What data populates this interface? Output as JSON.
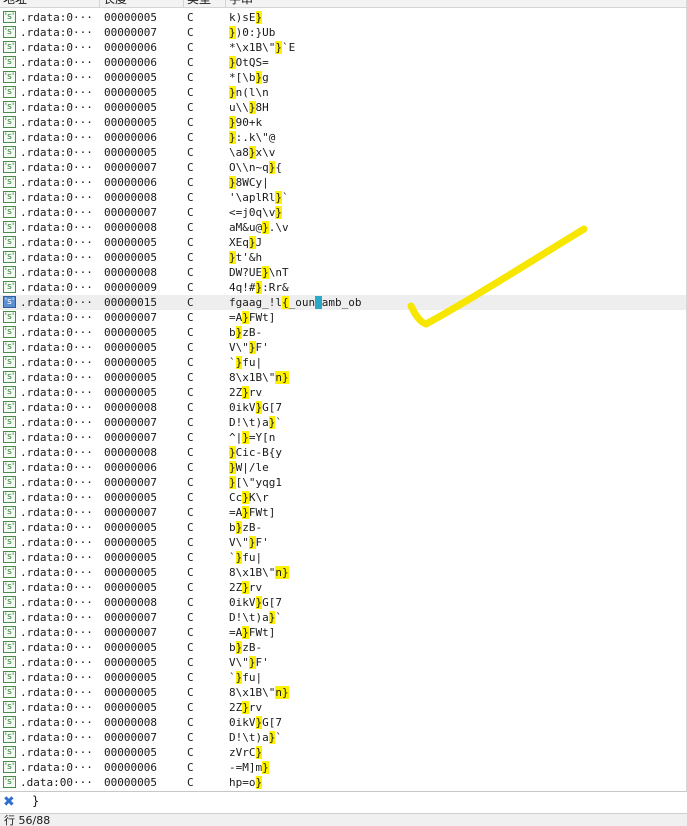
{
  "header": {
    "col_address": "地址",
    "col_length": "长度",
    "col_type": "类型",
    "col_string": "字串"
  },
  "icon": {
    "name": "string-item-icon",
    "glyph": "'s'"
  },
  "rows": [
    {
      "addr": ".rdata:0···",
      "len": "00000005",
      "type": "C",
      "s": [
        [
          "k)sE",
          0
        ],
        [
          "}",
          1
        ]
      ]
    },
    {
      "addr": ".rdata:0···",
      "len": "00000007",
      "type": "C",
      "s": [
        [
          "}",
          1
        ],
        [
          ")0:}Ub",
          0
        ]
      ]
    },
    {
      "addr": ".rdata:0···",
      "len": "00000006",
      "type": "C",
      "s": [
        [
          "*\\x1B\\\"",
          0
        ],
        [
          "}",
          1
        ],
        [
          "`E",
          0
        ]
      ]
    },
    {
      "addr": ".rdata:0···",
      "len": "00000006",
      "type": "C",
      "s": [
        [
          "}",
          1
        ],
        [
          "OtQS=",
          0
        ]
      ]
    },
    {
      "addr": ".rdata:0···",
      "len": "00000005",
      "type": "C",
      "s": [
        [
          "*[\\b",
          0
        ],
        [
          "}",
          1
        ],
        [
          "g",
          0
        ]
      ]
    },
    {
      "addr": ".rdata:0···",
      "len": "00000005",
      "type": "C",
      "s": [
        [
          "}",
          1
        ],
        [
          "n(l\\n",
          0
        ]
      ]
    },
    {
      "addr": ".rdata:0···",
      "len": "00000005",
      "type": "C",
      "s": [
        [
          "u\\\\",
          0
        ],
        [
          "}",
          1
        ],
        [
          "8H",
          0
        ]
      ]
    },
    {
      "addr": ".rdata:0···",
      "len": "00000005",
      "type": "C",
      "s": [
        [
          "}",
          1
        ],
        [
          "90+k",
          0
        ]
      ]
    },
    {
      "addr": ".rdata:0···",
      "len": "00000006",
      "type": "C",
      "s": [
        [
          "}",
          1
        ],
        [
          ":.k\\\"@",
          0
        ]
      ]
    },
    {
      "addr": ".rdata:0···",
      "len": "00000005",
      "type": "C",
      "s": [
        [
          "\\a8",
          0
        ],
        [
          "}",
          1
        ],
        [
          "x\\v",
          0
        ]
      ]
    },
    {
      "addr": ".rdata:0···",
      "len": "00000007",
      "type": "C",
      "s": [
        [
          "O\\\\n~q",
          0
        ],
        [
          "}",
          1
        ],
        [
          "{",
          0
        ]
      ]
    },
    {
      "addr": ".rdata:0···",
      "len": "00000006",
      "type": "C",
      "s": [
        [
          "}",
          1
        ],
        [
          "8WCy|",
          0
        ]
      ]
    },
    {
      "addr": ".rdata:0···",
      "len": "00000008",
      "type": "C",
      "s": [
        [
          "'\\aplRl",
          0
        ],
        [
          "}",
          1
        ],
        [
          "`",
          0
        ]
      ]
    },
    {
      "addr": ".rdata:0···",
      "len": "00000007",
      "type": "C",
      "s": [
        [
          "<=j0q\\v",
          0
        ],
        [
          "}",
          1
        ]
      ]
    },
    {
      "addr": ".rdata:0···",
      "len": "00000008",
      "type": "C",
      "s": [
        [
          "aM&u@",
          0
        ],
        [
          "}",
          1
        ],
        [
          ".\\v",
          0
        ]
      ]
    },
    {
      "addr": ".rdata:0···",
      "len": "00000005",
      "type": "C",
      "s": [
        [
          "XEq",
          0
        ],
        [
          "}",
          1
        ],
        [
          "J",
          0
        ]
      ]
    },
    {
      "addr": ".rdata:0···",
      "len": "00000005",
      "type": "C",
      "s": [
        [
          "}",
          1
        ],
        [
          "t'&h",
          0
        ]
      ]
    },
    {
      "addr": ".rdata:0···",
      "len": "00000008",
      "type": "C",
      "s": [
        [
          "DW?UE",
          0
        ],
        [
          "}",
          1
        ],
        [
          "\\nT",
          0
        ]
      ]
    },
    {
      "addr": ".rdata:0···",
      "len": "00000009",
      "type": "C",
      "s": [
        [
          "4q!#",
          0
        ],
        [
          "}",
          1
        ],
        [
          ":Rr&",
          0
        ]
      ]
    },
    {
      "addr": ".rdata:0···",
      "len": "00000015",
      "type": "C",
      "sel": true,
      "s": [
        [
          "fgaag_!l",
          0
        ],
        [
          "{",
          1
        ],
        [
          "_oun",
          0
        ],
        [
          "}",
          2
        ],
        [
          "amb_ob",
          0
        ]
      ]
    },
    {
      "addr": ".rdata:0···",
      "len": "00000007",
      "type": "C",
      "s": [
        [
          "=A",
          0
        ],
        [
          "}",
          1
        ],
        [
          "FWt]",
          0
        ]
      ]
    },
    {
      "addr": ".rdata:0···",
      "len": "00000005",
      "type": "C",
      "s": [
        [
          "b",
          0
        ],
        [
          "}",
          1
        ],
        [
          "zB-",
          0
        ]
      ]
    },
    {
      "addr": ".rdata:0···",
      "len": "00000005",
      "type": "C",
      "s": [
        [
          "V\\\"",
          0
        ],
        [
          "}",
          1
        ],
        [
          "F'",
          0
        ]
      ]
    },
    {
      "addr": ".rdata:0···",
      "len": "00000005",
      "type": "C",
      "s": [
        [
          "`",
          0
        ],
        [
          "}",
          1
        ],
        [
          "fu|",
          0
        ]
      ]
    },
    {
      "addr": ".rdata:0···",
      "len": "00000005",
      "type": "C",
      "s": [
        [
          "8\\x1B\\\"",
          0
        ],
        [
          "n",
          1
        ],
        [
          "}",
          1
        ]
      ]
    },
    {
      "addr": ".rdata:0···",
      "len": "00000005",
      "type": "C",
      "s": [
        [
          "2Z",
          0
        ],
        [
          "}",
          1
        ],
        [
          "rv",
          0
        ]
      ]
    },
    {
      "addr": ".rdata:0···",
      "len": "00000008",
      "type": "C",
      "s": [
        [
          "0ikV",
          0
        ],
        [
          "}",
          1
        ],
        [
          "G[7",
          0
        ]
      ]
    },
    {
      "addr": ".rdata:0···",
      "len": "00000007",
      "type": "C",
      "s": [
        [
          "D!\\t)a",
          0
        ],
        [
          "}",
          1
        ],
        [
          "`",
          0
        ]
      ]
    },
    {
      "addr": ".rdata:0···",
      "len": "00000007",
      "type": "C",
      "s": [
        [
          "^|",
          0
        ],
        [
          "}",
          1
        ],
        [
          "=Y[n",
          0
        ]
      ]
    },
    {
      "addr": ".rdata:0···",
      "len": "00000008",
      "type": "C",
      "s": [
        [
          "}",
          1
        ],
        [
          "Cic-B{y",
          0
        ]
      ]
    },
    {
      "addr": ".rdata:0···",
      "len": "00000006",
      "type": "C",
      "s": [
        [
          "}",
          1
        ],
        [
          "W|/le",
          0
        ]
      ]
    },
    {
      "addr": ".rdata:0···",
      "len": "00000007",
      "type": "C",
      "s": [
        [
          "}",
          1
        ],
        [
          "[\\\"yqg1",
          0
        ]
      ]
    },
    {
      "addr": ".rdata:0···",
      "len": "00000005",
      "type": "C",
      "s": [
        [
          "Cc",
          0
        ],
        [
          "}",
          1
        ],
        [
          "K\\r",
          0
        ]
      ]
    },
    {
      "addr": ".rdata:0···",
      "len": "00000007",
      "type": "C",
      "s": [
        [
          "=A",
          0
        ],
        [
          "}",
          1
        ],
        [
          "FWt]",
          0
        ]
      ]
    },
    {
      "addr": ".rdata:0···",
      "len": "00000005",
      "type": "C",
      "s": [
        [
          "b",
          0
        ],
        [
          "}",
          1
        ],
        [
          "zB-",
          0
        ]
      ]
    },
    {
      "addr": ".rdata:0···",
      "len": "00000005",
      "type": "C",
      "s": [
        [
          "V\\\"",
          0
        ],
        [
          "}",
          1
        ],
        [
          "F'",
          0
        ]
      ]
    },
    {
      "addr": ".rdata:0···",
      "len": "00000005",
      "type": "C",
      "s": [
        [
          "`",
          0
        ],
        [
          "}",
          1
        ],
        [
          "fu|",
          0
        ]
      ]
    },
    {
      "addr": ".rdata:0···",
      "len": "00000005",
      "type": "C",
      "s": [
        [
          "8\\x1B\\\"",
          0
        ],
        [
          "n",
          1
        ],
        [
          "}",
          1
        ]
      ]
    },
    {
      "addr": ".rdata:0···",
      "len": "00000005",
      "type": "C",
      "s": [
        [
          "2Z",
          0
        ],
        [
          "}",
          1
        ],
        [
          "rv",
          0
        ]
      ]
    },
    {
      "addr": ".rdata:0···",
      "len": "00000008",
      "type": "C",
      "s": [
        [
          "0ikV",
          0
        ],
        [
          "}",
          1
        ],
        [
          "G[7",
          0
        ]
      ]
    },
    {
      "addr": ".rdata:0···",
      "len": "00000007",
      "type": "C",
      "s": [
        [
          "D!\\t)a",
          0
        ],
        [
          "}",
          1
        ],
        [
          "`",
          0
        ]
      ]
    },
    {
      "addr": ".rdata:0···",
      "len": "00000007",
      "type": "C",
      "s": [
        [
          "=A",
          0
        ],
        [
          "}",
          1
        ],
        [
          "FWt]",
          0
        ]
      ]
    },
    {
      "addr": ".rdata:0···",
      "len": "00000005",
      "type": "C",
      "s": [
        [
          "b",
          0
        ],
        [
          "}",
          1
        ],
        [
          "zB-",
          0
        ]
      ]
    },
    {
      "addr": ".rdata:0···",
      "len": "00000005",
      "type": "C",
      "s": [
        [
          "V\\\"",
          0
        ],
        [
          "}",
          1
        ],
        [
          "F'",
          0
        ]
      ]
    },
    {
      "addr": ".rdata:0···",
      "len": "00000005",
      "type": "C",
      "s": [
        [
          "`",
          0
        ],
        [
          "}",
          1
        ],
        [
          "fu|",
          0
        ]
      ]
    },
    {
      "addr": ".rdata:0···",
      "len": "00000005",
      "type": "C",
      "s": [
        [
          "8\\x1B\\\"",
          0
        ],
        [
          "n",
          1
        ],
        [
          "}",
          1
        ]
      ]
    },
    {
      "addr": ".rdata:0···",
      "len": "00000005",
      "type": "C",
      "s": [
        [
          "2Z",
          0
        ],
        [
          "}",
          1
        ],
        [
          "rv",
          0
        ]
      ]
    },
    {
      "addr": ".rdata:0···",
      "len": "00000008",
      "type": "C",
      "s": [
        [
          "0ikV",
          0
        ],
        [
          "}",
          1
        ],
        [
          "G[7",
          0
        ]
      ]
    },
    {
      "addr": ".rdata:0···",
      "len": "00000007",
      "type": "C",
      "s": [
        [
          "D!\\t)a",
          0
        ],
        [
          "}",
          1
        ],
        [
          "`",
          0
        ]
      ]
    },
    {
      "addr": ".rdata:0···",
      "len": "00000005",
      "type": "C",
      "s": [
        [
          "zVrC",
          0
        ],
        [
          "}",
          1
        ]
      ]
    },
    {
      "addr": ".rdata:0···",
      "len": "00000006",
      "type": "C",
      "s": [
        [
          "-=M]m",
          0
        ],
        [
          "}",
          1
        ]
      ]
    },
    {
      "addr": ".data:00···",
      "len": "00000005",
      "type": "C",
      "s": [
        [
          "hp=o",
          0
        ],
        [
          "}",
          1
        ]
      ]
    }
  ],
  "editor": {
    "value": "}"
  },
  "status": {
    "text": "行 56/88"
  },
  "colors": {
    "highlight": "#fff200",
    "cursor": "#2aa8c8",
    "annotation": "#f7e600"
  },
  "annotation": {
    "shape": "checkmark"
  }
}
